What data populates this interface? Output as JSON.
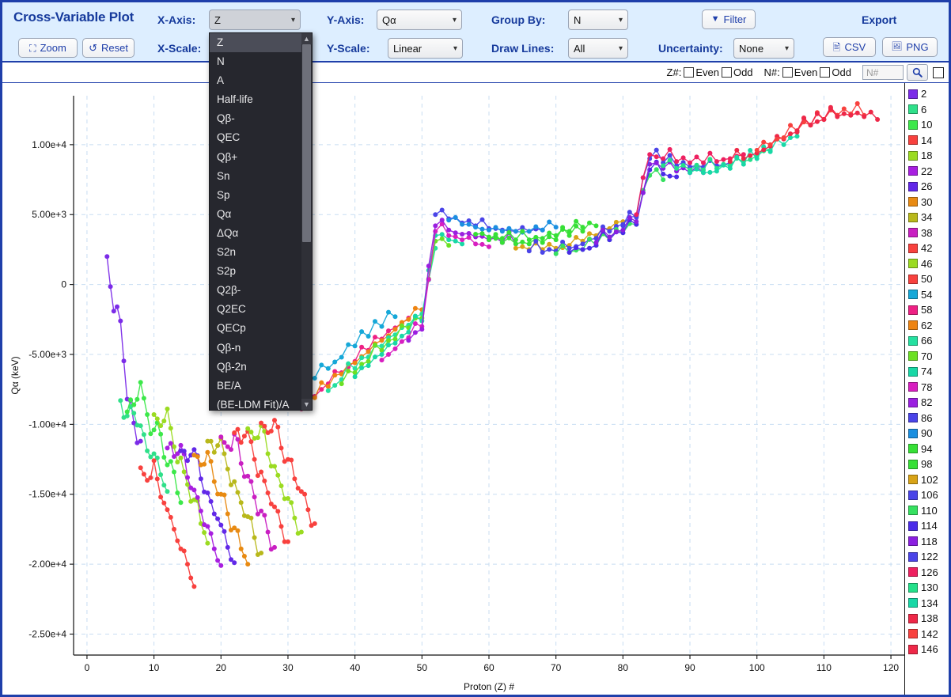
{
  "app": {
    "title": "Cross-Variable Plot"
  },
  "toolbar": {
    "zoom_label": "Zoom",
    "reset_label": "Reset",
    "x_axis_label": "X-Axis:",
    "x_scale_label": "X-Scale:",
    "y_axis_label": "Y-Axis:",
    "y_scale_label": "Y-Scale:",
    "group_by_label": "Group By:",
    "draw_lines_label": "Draw Lines:",
    "uncertainty_label": "Uncertainty:",
    "filter_label": "Filter",
    "export_label": "Export",
    "csv_label": "CSV",
    "png_label": "PNG",
    "x_axis_value": "Z",
    "x_scale_value": "",
    "y_axis_value": "Qα",
    "y_scale_value": "Linear",
    "group_by_value": "N",
    "draw_lines_value": "All",
    "uncertainty_value": "None"
  },
  "dropdown": {
    "open": true,
    "selected": "Z",
    "options": [
      "Z",
      "N",
      "A",
      "Half-life",
      "Qβ-",
      "QEC",
      "Qβ+",
      "Sn",
      "Sp",
      "Qα",
      "ΔQα",
      "S2n",
      "S2p",
      "Q2β-",
      "Q2EC",
      "QECp",
      "Qβ-n",
      "Qβ-2n",
      "BE/A",
      "(BE-LDM Fit)/A"
    ]
  },
  "filter_bar": {
    "z_tag": "Z#:",
    "n_tag": "N#:",
    "even_label": "Even",
    "odd_label": "Odd",
    "n_input_value": "",
    "n_input_placeholder": "N#",
    "search_icon": "search-icon",
    "legend_toggle_checked": false
  },
  "legend": {
    "entries": [
      {
        "label": "2",
        "color": "#7B2BE8"
      },
      {
        "label": "6",
        "color": "#2FE08A"
      },
      {
        "label": "10",
        "color": "#3CE84A"
      },
      {
        "label": "14",
        "color": "#F8413E"
      },
      {
        "label": "18",
        "color": "#9BDB21"
      },
      {
        "label": "22",
        "color": "#A81FE0"
      },
      {
        "label": "26",
        "color": "#6128E8"
      },
      {
        "label": "30",
        "color": "#E88A12"
      },
      {
        "label": "34",
        "color": "#B8B81B"
      },
      {
        "label": "38",
        "color": "#C91FC2"
      },
      {
        "label": "42",
        "color": "#F8413E"
      },
      {
        "label": "46",
        "color": "#9BDB21"
      },
      {
        "label": "50",
        "color": "#F8413E"
      },
      {
        "label": "54",
        "color": "#16A8D8"
      },
      {
        "label": "58",
        "color": "#EE2084"
      },
      {
        "label": "62",
        "color": "#EE8412"
      },
      {
        "label": "66",
        "color": "#24E0A0"
      },
      {
        "label": "70",
        "color": "#6CE024"
      },
      {
        "label": "74",
        "color": "#18D8A6"
      },
      {
        "label": "78",
        "color": "#D81FC0"
      },
      {
        "label": "82",
        "color": "#9B1FE0"
      },
      {
        "label": "86",
        "color": "#4A44E8"
      },
      {
        "label": "90",
        "color": "#1B8FE0"
      },
      {
        "label": "94",
        "color": "#36E036"
      },
      {
        "label": "98",
        "color": "#36E036"
      },
      {
        "label": "102",
        "color": "#D8A316"
      },
      {
        "label": "106",
        "color": "#4A44E8"
      },
      {
        "label": "110",
        "color": "#36E060"
      },
      {
        "label": "114",
        "color": "#4A2BE8"
      },
      {
        "label": "118",
        "color": "#8B1FE0"
      },
      {
        "label": "122",
        "color": "#4A44E8"
      },
      {
        "label": "126",
        "color": "#EE2060"
      },
      {
        "label": "130",
        "color": "#24E08A"
      },
      {
        "label": "134",
        "color": "#18D8A6"
      },
      {
        "label": "138",
        "color": "#EE2848"
      },
      {
        "label": "142",
        "color": "#F8413E"
      },
      {
        "label": "146",
        "color": "#EE2848"
      }
    ]
  },
  "chart_data": {
    "type": "scatter",
    "title": "",
    "xlabel": "Proton (Z) #",
    "ylabel": "Qα (keV)",
    "xlim": [
      -2,
      122
    ],
    "ylim": [
      -26500,
      13500
    ],
    "xticks": [
      0,
      10,
      20,
      30,
      40,
      50,
      60,
      70,
      80,
      90,
      100,
      110,
      120
    ],
    "xticklabels": [
      "0",
      "10",
      "20",
      "30",
      "40",
      "50",
      "60",
      "70",
      "80",
      "90",
      "100",
      "110",
      "120"
    ],
    "yticks": [
      10000,
      5000,
      0,
      -5000,
      -10000,
      -15000,
      -20000,
      -25000
    ],
    "yticklabels": [
      "1.00e+4",
      "5.00e+3",
      "0",
      "-5.00e+3",
      "-1.00e+4",
      "-1.50e+4",
      "-2.00e+4",
      "-2.50e+4"
    ],
    "grid": true,
    "grid_style": "dashed",
    "grid_color": "#c8ddf2",
    "legend_position": "right",
    "legend_title": "N",
    "group_by": "N",
    "draw_lines": "All",
    "marker_size": 3,
    "series_count": 37,
    "description": "Alpha-decay Q-value (Qα) versus proton number Z, one polyline series per even neutron number N from 2 to 146. Values rise roughly monotonically from about -2.5e+4 keV near Z=7 to about +1.2e+4 keV near Z=118, with a sharp discontinuity near Z=51 and a smaller step near Z=83.",
    "series": [
      {
        "name": "2",
        "color": "#7B2BE8",
        "x": [
          3,
          4,
          5,
          6,
          7,
          8
        ],
        "y": [
          2000,
          -1900,
          -2600,
          -8200,
          -9900,
          -11200
        ]
      },
      {
        "name": "6",
        "color": "#2FE08A",
        "x": [
          5,
          6,
          7,
          8,
          9,
          10,
          11,
          12
        ],
        "y": [
          -8300,
          -9400,
          -9200,
          -10100,
          -11900,
          -12100,
          -13600,
          -14800
        ]
      },
      {
        "name": "10",
        "color": "#3CE84A",
        "x": [
          6,
          7,
          8,
          9,
          10,
          11,
          12,
          13,
          14
        ],
        "y": [
          -9100,
          -8600,
          -7000,
          -9300,
          -10400,
          -10700,
          -12900,
          -13400,
          -15600
        ]
      },
      {
        "name": "14",
        "color": "#F8413E",
        "x": [
          8,
          9,
          10,
          11,
          12,
          13,
          14,
          15,
          16
        ],
        "y": [
          -13100,
          -14000,
          -12600,
          -15200,
          -16100,
          -17500,
          -18900,
          -20000,
          -21600
        ]
      },
      {
        "name": "18",
        "color": "#9BDB21",
        "x": [
          10,
          11,
          12,
          13,
          14,
          15,
          16,
          17,
          18
        ],
        "y": [
          -9300,
          -10100,
          -8900,
          -11600,
          -12400,
          -14300,
          -15400,
          -17100,
          -18500
        ]
      },
      {
        "name": "22",
        "color": "#A81FE0",
        "x": [
          12,
          13,
          14,
          15,
          16,
          17,
          18,
          19,
          20
        ],
        "y": [
          -11700,
          -12300,
          -11500,
          -13800,
          -14700,
          -16200,
          -17300,
          -18900,
          -20100
        ]
      },
      {
        "name": "26",
        "color": "#6128E8",
        "x": [
          14,
          15,
          16,
          17,
          18,
          19,
          20,
          21,
          22
        ],
        "y": [
          -11900,
          -12600,
          -11800,
          -13900,
          -14900,
          -16400,
          -17200,
          -18800,
          -19900
        ]
      },
      {
        "name": "30",
        "color": "#E88A12",
        "x": [
          16,
          17,
          18,
          19,
          20,
          21,
          22,
          23,
          24
        ],
        "y": [
          -12200,
          -12900,
          -12000,
          -14100,
          -15000,
          -16400,
          -17400,
          -18900,
          -20000
        ]
      },
      {
        "name": "34",
        "color": "#B8B81B",
        "x": [
          18,
          19,
          20,
          21,
          22,
          23,
          24,
          25,
          26
        ],
        "y": [
          -11200,
          -12000,
          -11000,
          -13200,
          -14100,
          -15600,
          -16600,
          -18100,
          -19200
        ]
      },
      {
        "name": "38",
        "color": "#C91FC2",
        "x": [
          20,
          21,
          22,
          23,
          24,
          25,
          26,
          27,
          28
        ],
        "y": [
          -10900,
          -11600,
          -10700,
          -12800,
          -13700,
          -15200,
          -16200,
          -17700,
          -18800
        ]
      },
      {
        "name": "42",
        "color": "#F8413E",
        "x": [
          22,
          23,
          24,
          25,
          26,
          27,
          28,
          29,
          30
        ],
        "y": [
          -10600,
          -11300,
          -10500,
          -12500,
          -13400,
          -14900,
          -15900,
          -17300,
          -18400
        ]
      },
      {
        "name": "46",
        "color": "#9BDB21",
        "x": [
          24,
          25,
          26,
          27,
          28,
          29,
          30,
          31,
          32
        ],
        "y": [
          -10300,
          -11000,
          -10100,
          -12100,
          -13000,
          -14400,
          -15300,
          -16700,
          -17700
        ]
      },
      {
        "name": "50",
        "color": "#F8413E",
        "x": [
          26,
          27,
          28,
          29,
          30,
          31,
          32,
          33,
          34
        ],
        "y": [
          -9900,
          -10600,
          -9700,
          -11700,
          -12500,
          -13900,
          -14800,
          -16100,
          -17100
        ]
      },
      {
        "name": "54",
        "color": "#16A8D8",
        "x": [
          30,
          32,
          34,
          36,
          38,
          40,
          42,
          44,
          46
        ],
        "y": [
          -8400,
          -7600,
          -6700,
          -6000,
          -5200,
          -4400,
          -3700,
          -3000,
          -2300
        ]
      },
      {
        "name": "58",
        "color": "#EE2084",
        "x": [
          32,
          34,
          36,
          38,
          40,
          42,
          44,
          46,
          48
        ],
        "y": [
          -8900,
          -8000,
          -7100,
          -6300,
          -5500,
          -4700,
          -3900,
          -3100,
          -2400
        ]
      },
      {
        "name": "62",
        "color": "#EE8412",
        "x": [
          34,
          36,
          38,
          40,
          42,
          44,
          46,
          48,
          50
        ],
        "y": [
          -8100,
          -7300,
          -6400,
          -5600,
          -4800,
          -4000,
          -3200,
          -2500,
          -1800
        ]
      },
      {
        "name": "66",
        "color": "#24E0A0",
        "x": [
          36,
          38,
          40,
          42,
          44,
          46,
          48,
          50,
          52
        ],
        "y": [
          -7600,
          -6800,
          -6000,
          -5200,
          -4400,
          -3600,
          -2900,
          -2100,
          2600
        ]
      },
      {
        "name": "70",
        "color": "#6CE024",
        "x": [
          38,
          40,
          42,
          44,
          46,
          48,
          50,
          52,
          54
        ],
        "y": [
          -7100,
          -6300,
          -5500,
          -4700,
          -3900,
          -3100,
          -2400,
          3100,
          2800
        ]
      },
      {
        "name": "74",
        "color": "#18D8A6",
        "x": [
          40,
          42,
          44,
          46,
          48,
          50,
          52,
          54,
          56
        ],
        "y": [
          -6600,
          -5800,
          -5000,
          -4200,
          -3400,
          -2600,
          3500,
          3200,
          2900
        ]
      },
      {
        "name": "78",
        "color": "#D81FC0",
        "x": [
          44,
          46,
          48,
          50,
          52,
          54,
          56,
          58,
          60
        ],
        "y": [
          -5400,
          -4600,
          -3800,
          -3000,
          3800,
          3500,
          3200,
          2900,
          2700
        ]
      },
      {
        "name": "82",
        "color": "#9B1FE0",
        "x": [
          48,
          50,
          52,
          54,
          56,
          58,
          60,
          62,
          64
        ],
        "y": [
          -4000,
          -3200,
          4200,
          3900,
          3600,
          3400,
          3200,
          3000,
          2900
        ]
      },
      {
        "name": "86",
        "color": "#4A44E8",
        "x": [
          52,
          54,
          56,
          58,
          60,
          62,
          64,
          66,
          68
        ],
        "y": [
          5000,
          4700,
          4400,
          4200,
          4000,
          3900,
          3800,
          3800,
          3900
        ]
      },
      {
        "name": "90",
        "color": "#1B8FE0",
        "x": [
          54,
          56,
          58,
          60,
          62,
          64,
          66,
          68,
          70
        ],
        "y": [
          4600,
          4300,
          4100,
          3900,
          3800,
          3800,
          3800,
          3900,
          4100
        ]
      },
      {
        "name": "94",
        "color": "#36E036",
        "x": [
          58,
          60,
          62,
          64,
          66,
          68,
          70,
          72,
          74
        ],
        "y": [
          3600,
          3400,
          3300,
          3200,
          3200,
          3300,
          3500,
          3800,
          4100
        ]
      },
      {
        "name": "98",
        "color": "#36E036",
        "x": [
          60,
          62,
          64,
          66,
          68,
          70,
          72,
          74,
          76
        ],
        "y": [
          3200,
          3000,
          2900,
          2900,
          3000,
          3200,
          3500,
          3800,
          4200
        ]
      },
      {
        "name": "102",
        "color": "#D8A316",
        "x": [
          64,
          66,
          68,
          70,
          72,
          74,
          76,
          78,
          80
        ],
        "y": [
          2600,
          2500,
          2500,
          2600,
          2800,
          3100,
          3500,
          4000,
          4500
        ]
      },
      {
        "name": "106",
        "color": "#4A44E8",
        "x": [
          66,
          68,
          70,
          72,
          74,
          76,
          78,
          80,
          82
        ],
        "y": [
          2400,
          2300,
          2400,
          2600,
          2900,
          3300,
          3800,
          4300,
          4900
        ]
      },
      {
        "name": "110",
        "color": "#36E060",
        "x": [
          70,
          72,
          74,
          76,
          78,
          80,
          82,
          84,
          86
        ],
        "y": [
          2200,
          2300,
          2500,
          2800,
          3200,
          3700,
          4300,
          7800,
          7500
        ]
      },
      {
        "name": "114",
        "color": "#4A2BE8",
        "x": [
          72,
          74,
          76,
          78,
          80,
          82,
          84,
          86,
          88
        ],
        "y": [
          2300,
          2500,
          2800,
          3200,
          3700,
          4300,
          8200,
          7900,
          7700
        ]
      },
      {
        "name": "118",
        "color": "#8B1FE0",
        "x": [
          76,
          78,
          80,
          82,
          84,
          86,
          88,
          90,
          92
        ],
        "y": [
          3000,
          3400,
          3900,
          4500,
          8600,
          8300,
          8100,
          8000,
          8000
        ]
      },
      {
        "name": "122",
        "color": "#4A44E8",
        "x": [
          80,
          82,
          84,
          86,
          88,
          90,
          92,
          94,
          96
        ],
        "y": [
          4200,
          4800,
          9000,
          8700,
          8500,
          8400,
          8400,
          8500,
          8700
        ]
      },
      {
        "name": "126",
        "color": "#EE2060",
        "x": [
          82,
          84,
          86,
          88,
          90,
          92,
          94,
          96,
          98
        ],
        "y": [
          5000,
          9300,
          9000,
          8800,
          8700,
          8700,
          8800,
          9000,
          9300
        ]
      },
      {
        "name": "130",
        "color": "#24E08A",
        "x": [
          86,
          88,
          90,
          92,
          94,
          96,
          98,
          100,
          102
        ],
        "y": [
          8500,
          8300,
          8200,
          8200,
          8300,
          8500,
          8800,
          9200,
          9600
        ]
      },
      {
        "name": "134",
        "color": "#18D8A6",
        "x": [
          90,
          92,
          94,
          96,
          98,
          100,
          102,
          104,
          106
        ],
        "y": [
          8000,
          8000,
          8100,
          8300,
          8600,
          9000,
          9500,
          10000,
          10600
        ]
      },
      {
        "name": "138",
        "color": "#EE2848",
        "x": [
          96,
          98,
          100,
          102,
          104,
          106,
          108,
          110,
          112
        ],
        "y": [
          8800,
          9000,
          9400,
          9900,
          10400,
          10900,
          11400,
          11800,
          12100
        ]
      },
      {
        "name": "142",
        "color": "#F8413E",
        "x": [
          100,
          102,
          104,
          106,
          108,
          110,
          112,
          114,
          116
        ],
        "y": [
          9600,
          10000,
          10500,
          11000,
          11400,
          11800,
          12100,
          12200,
          12100
        ]
      },
      {
        "name": "146",
        "color": "#EE2848",
        "x": [
          106,
          108,
          110,
          112,
          114,
          116,
          118
        ],
        "y": [
          11000,
          11400,
          11800,
          12000,
          12100,
          12000,
          11800
        ]
      }
    ]
  }
}
